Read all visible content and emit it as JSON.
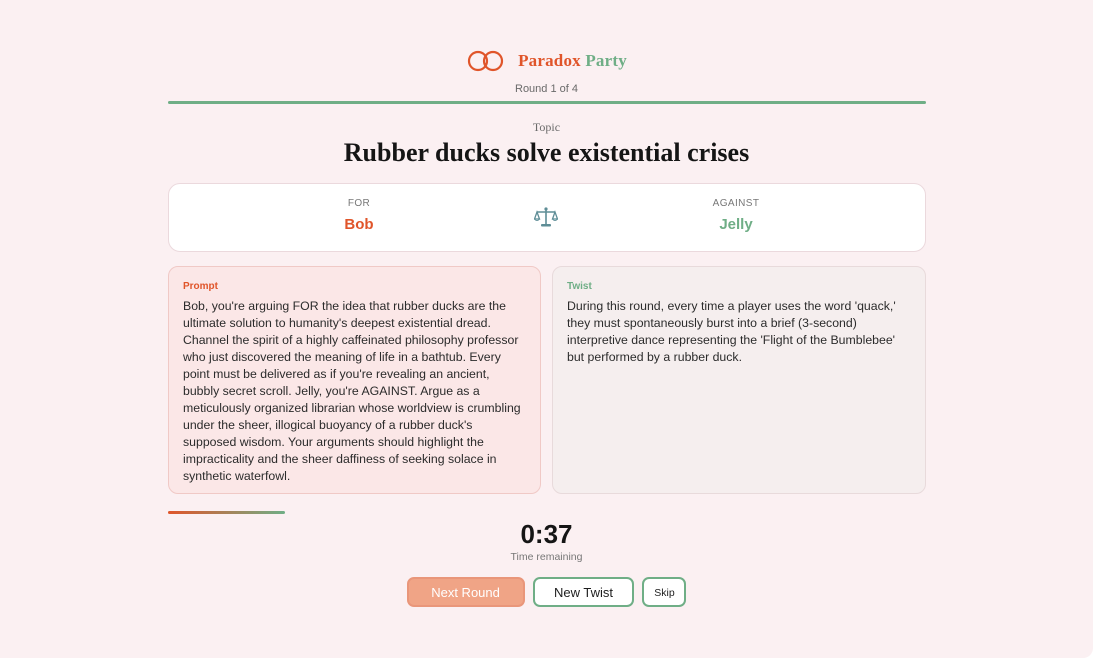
{
  "app": {
    "brand_first": "Paradox",
    "brand_second": "Party",
    "round_text": "Round 1 of 4"
  },
  "topic": {
    "label": "Topic",
    "title": "Rubber ducks solve existential crises"
  },
  "versus": {
    "for_label": "FOR",
    "for_name": "Bob",
    "against_label": "AGAINST",
    "against_name": "Jelly"
  },
  "prompt": {
    "label": "Prompt",
    "text": "Bob, you're arguing FOR the idea that rubber ducks are the ultimate solution to humanity's deepest existential dread. Channel the spirit of a highly caffeinated philosophy professor who just discovered the meaning of life in a bathtub. Every point must be delivered as if you're revealing an ancient, bubbly secret scroll. Jelly, you're AGAINST. Argue as a meticulously organized librarian whose worldview is crumbling under the sheer, illogical buoyancy of a rubber duck's supposed wisdom. Your arguments should highlight the impracticality and the sheer daffiness of seeking solace in synthetic waterfowl."
  },
  "twist": {
    "label": "Twist",
    "text": "During this round, every time a player uses the word 'quack,' they must spontaneously burst into a brief (3-second) interpretive dance representing the 'Flight of the Bumblebee' but performed by a rubber duck."
  },
  "timer": {
    "value": "0:37",
    "label": "Time remaining",
    "progress_fraction": 0.15
  },
  "buttons": {
    "next": "Next Round",
    "new_twist": "New Twist",
    "skip": "Skip"
  },
  "colors": {
    "accent_orange": "#e0552a",
    "accent_green": "#6fae86",
    "background": "#fbf0f2"
  },
  "icons": {
    "logo": "linked-rings-icon",
    "versus": "scales-icon"
  }
}
